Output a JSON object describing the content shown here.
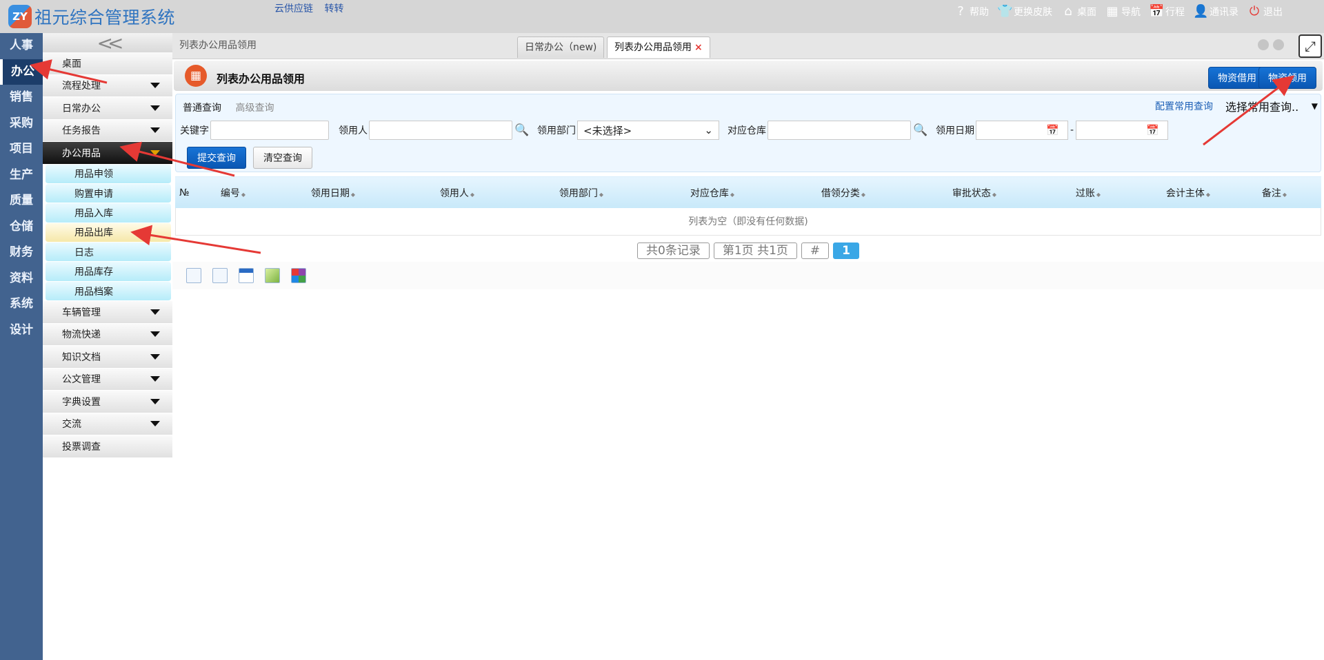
{
  "header": {
    "logo_text": "ZY",
    "app_title": "祖元综合管理系统",
    "links": [
      "云供应链",
      "转转"
    ],
    "actions": [
      {
        "label": "帮助",
        "icon": "help-icon",
        "glyph": "?"
      },
      {
        "label": "更换皮肤",
        "icon": "shirt-icon",
        "glyph": "👕"
      },
      {
        "label": "桌面",
        "icon": "home-icon",
        "glyph": "⌂"
      },
      {
        "label": "导航",
        "icon": "grid-icon",
        "glyph": "▦"
      },
      {
        "label": "行程",
        "icon": "calendar-icon",
        "glyph": "📅"
      },
      {
        "label": "通讯录",
        "icon": "contact-icon",
        "glyph": "👤"
      },
      {
        "label": "退出",
        "icon": "power-icon",
        "glyph": "⏻"
      }
    ]
  },
  "modules": [
    "人事",
    "办公",
    "销售",
    "采购",
    "项目",
    "生产",
    "质量",
    "仓储",
    "财务",
    "资料",
    "系统",
    "设计"
  ],
  "active_module": "办公",
  "menu": {
    "collapse_label": "<<",
    "top_items": [
      {
        "label": "桌面",
        "caret": false
      },
      {
        "label": "流程处理",
        "caret": true
      },
      {
        "label": "日常办公",
        "caret": true
      },
      {
        "label": "任务报告",
        "caret": true
      }
    ],
    "expanded_group": {
      "label": "办公用品"
    },
    "sub_items": [
      "用品申领",
      "购置申请",
      "用品入库",
      "用品出库",
      "日志",
      "用品库存",
      "用品档案"
    ],
    "active_sub": "用品出库",
    "bottom_items": [
      {
        "label": "车辆管理",
        "caret": true
      },
      {
        "label": "物流快递",
        "caret": true
      },
      {
        "label": "知识文档",
        "caret": true
      },
      {
        "label": "公文管理",
        "caret": true
      },
      {
        "label": "字典设置",
        "caret": true
      },
      {
        "label": "交流",
        "caret": true
      },
      {
        "label": "投票调查",
        "caret": false
      }
    ]
  },
  "tabs": {
    "breadcrumb": "列表办公用品领用",
    "items": [
      {
        "label": "日常办公（new)",
        "active": false
      },
      {
        "label": "列表办公用品领用",
        "active": true,
        "close": "×"
      }
    ],
    "maximize_glyph": "⤢"
  },
  "page": {
    "title": "列表办公用品领用",
    "title_icon_glyph": "▦",
    "buttons": [
      "物资借用",
      "物资领用"
    ]
  },
  "query": {
    "tab_normal": "普通查询",
    "tab_advanced": "高级查询",
    "config_link": "配置常用查询",
    "preset_select": "选择常用查询..",
    "fields": {
      "keyword_label": "关键字",
      "keyword_value": "",
      "receiver_label": "领用人",
      "receiver_value": "",
      "dept_label": "领用部门",
      "dept_value": "<未选择>",
      "warehouse_label": "对应仓库",
      "warehouse_value": "",
      "date_label": "领用日期",
      "date_from": "",
      "date_to": "",
      "date_sep": "-"
    },
    "submit": "提交查询",
    "clear": "清空查询"
  },
  "table": {
    "columns": [
      "№",
      "编号",
      "领用日期",
      "领用人",
      "领用部门",
      "对应仓库",
      "借领分类",
      "审批状态",
      "过账",
      "会计主体",
      "备注"
    ],
    "empty_text": "列表为空（即没有任何数据)"
  },
  "pager": {
    "total": "共0条记录",
    "pages": "第1页 共1页",
    "hash": "#",
    "current": "1"
  },
  "toolbar_icons": [
    "select-icon",
    "document-icon",
    "calendar-table-icon",
    "edit-icon",
    "puzzle-icon"
  ],
  "colors": {
    "module_bar": "#42638f",
    "active_module": "#1c3d6a",
    "primary_button": "#0a57b3",
    "annotation_arrow": "#e53935"
  }
}
